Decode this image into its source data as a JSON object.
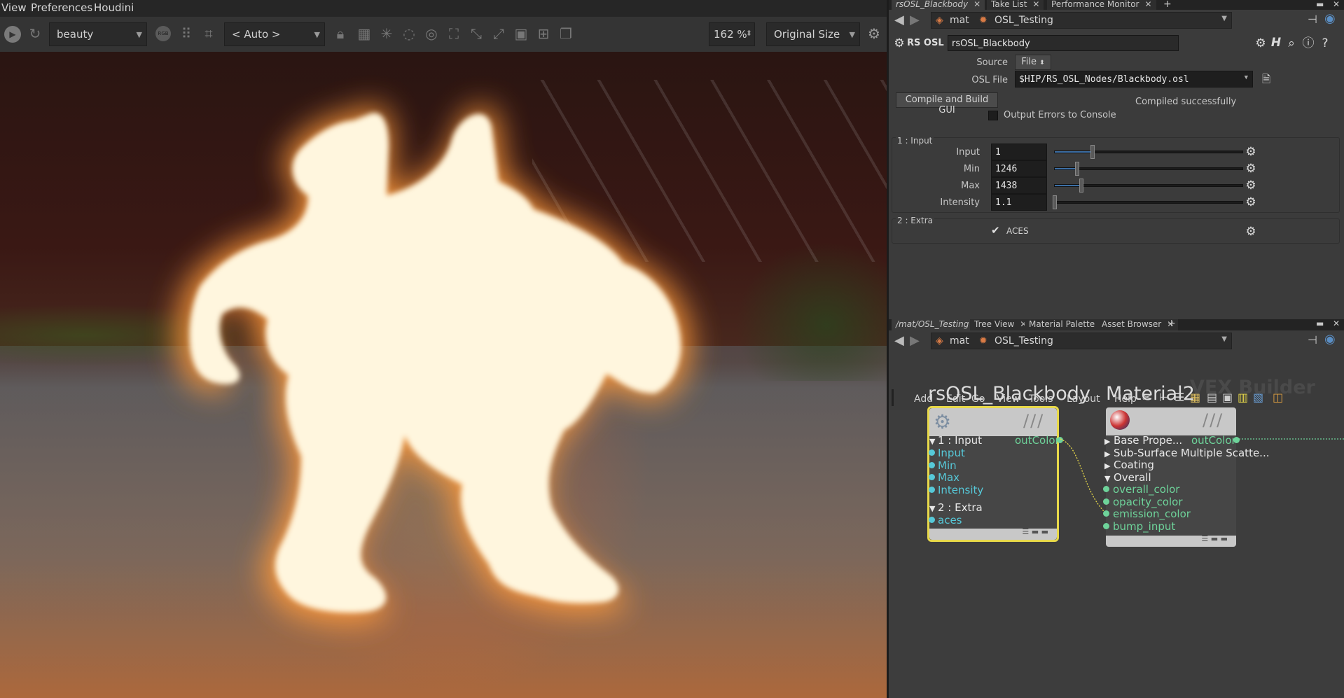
{
  "menubar": {
    "items": [
      "View",
      "Preferences",
      "Houdini"
    ]
  },
  "viewer": {
    "aov": "beauty",
    "rgb_badge": "RGB",
    "camera": "< Auto >",
    "zoom": "162 %",
    "size_mode": "Original Size"
  },
  "params_pane": {
    "tabs": [
      "rsOSL_Blackbody",
      "Take List",
      "Performance Monitor"
    ],
    "path": {
      "context": "mat",
      "node": "OSL_Testing"
    },
    "node_type": "RS OSL",
    "node_name": "rsOSL_Blackbody",
    "source_label": "Source",
    "source_value": "File",
    "osl_file_label": "OSL File",
    "osl_file_value": "$HIP/RS_OSL_Nodes/Blackbody.osl",
    "compile_button": "Compile and Build GUI",
    "compile_status": "Compiled successfully",
    "output_errors_label": "Output Errors to Console",
    "group1": {
      "title": "1 : Input",
      "params": [
        {
          "label": "Input",
          "value": "1",
          "slider": 0.2
        },
        {
          "label": "Min",
          "value": "1246",
          "slider": 0.12
        },
        {
          "label": "Max",
          "value": "1438",
          "slider": 0.14
        },
        {
          "label": "Intensity",
          "value": "1.1",
          "slider": 0.0
        }
      ]
    },
    "group2": {
      "title": "2 : Extra",
      "checkbox_label": "ACES",
      "checked": true
    }
  },
  "network_pane": {
    "tabs": [
      "/mat/OSL_Testing",
      "Tree View",
      "Material Palette",
      "Asset Browser"
    ],
    "path": {
      "context": "mat",
      "node": "OSL_Testing"
    },
    "menu": [
      "Add",
      "Edit",
      "Go",
      "View",
      "Tools",
      "Layout",
      "Help"
    ],
    "watermark": "VEX Builder",
    "node1": {
      "title": "rsOSL_Blackbody",
      "sections": [
        "1 : Input",
        "2 : Extra"
      ],
      "inputs1": [
        "Input",
        "Min",
        "Max",
        "Intensity"
      ],
      "inputs2": [
        "aces"
      ],
      "output": "outColor"
    },
    "node2": {
      "title": "Material2",
      "output": "outColor",
      "folders": [
        "Base Prope...",
        "Sub-Surface Multiple Scatte...",
        "Coating",
        "Overall"
      ],
      "inputs": [
        "overall_color",
        "opacity_color",
        "emission_color",
        "bump_input"
      ]
    }
  },
  "colors": {
    "accent_yellow": "#e8d94a",
    "port_cyan": "#56c8d8",
    "port_green": "#6ed39a",
    "slider_blue": "#3d6fa5"
  }
}
